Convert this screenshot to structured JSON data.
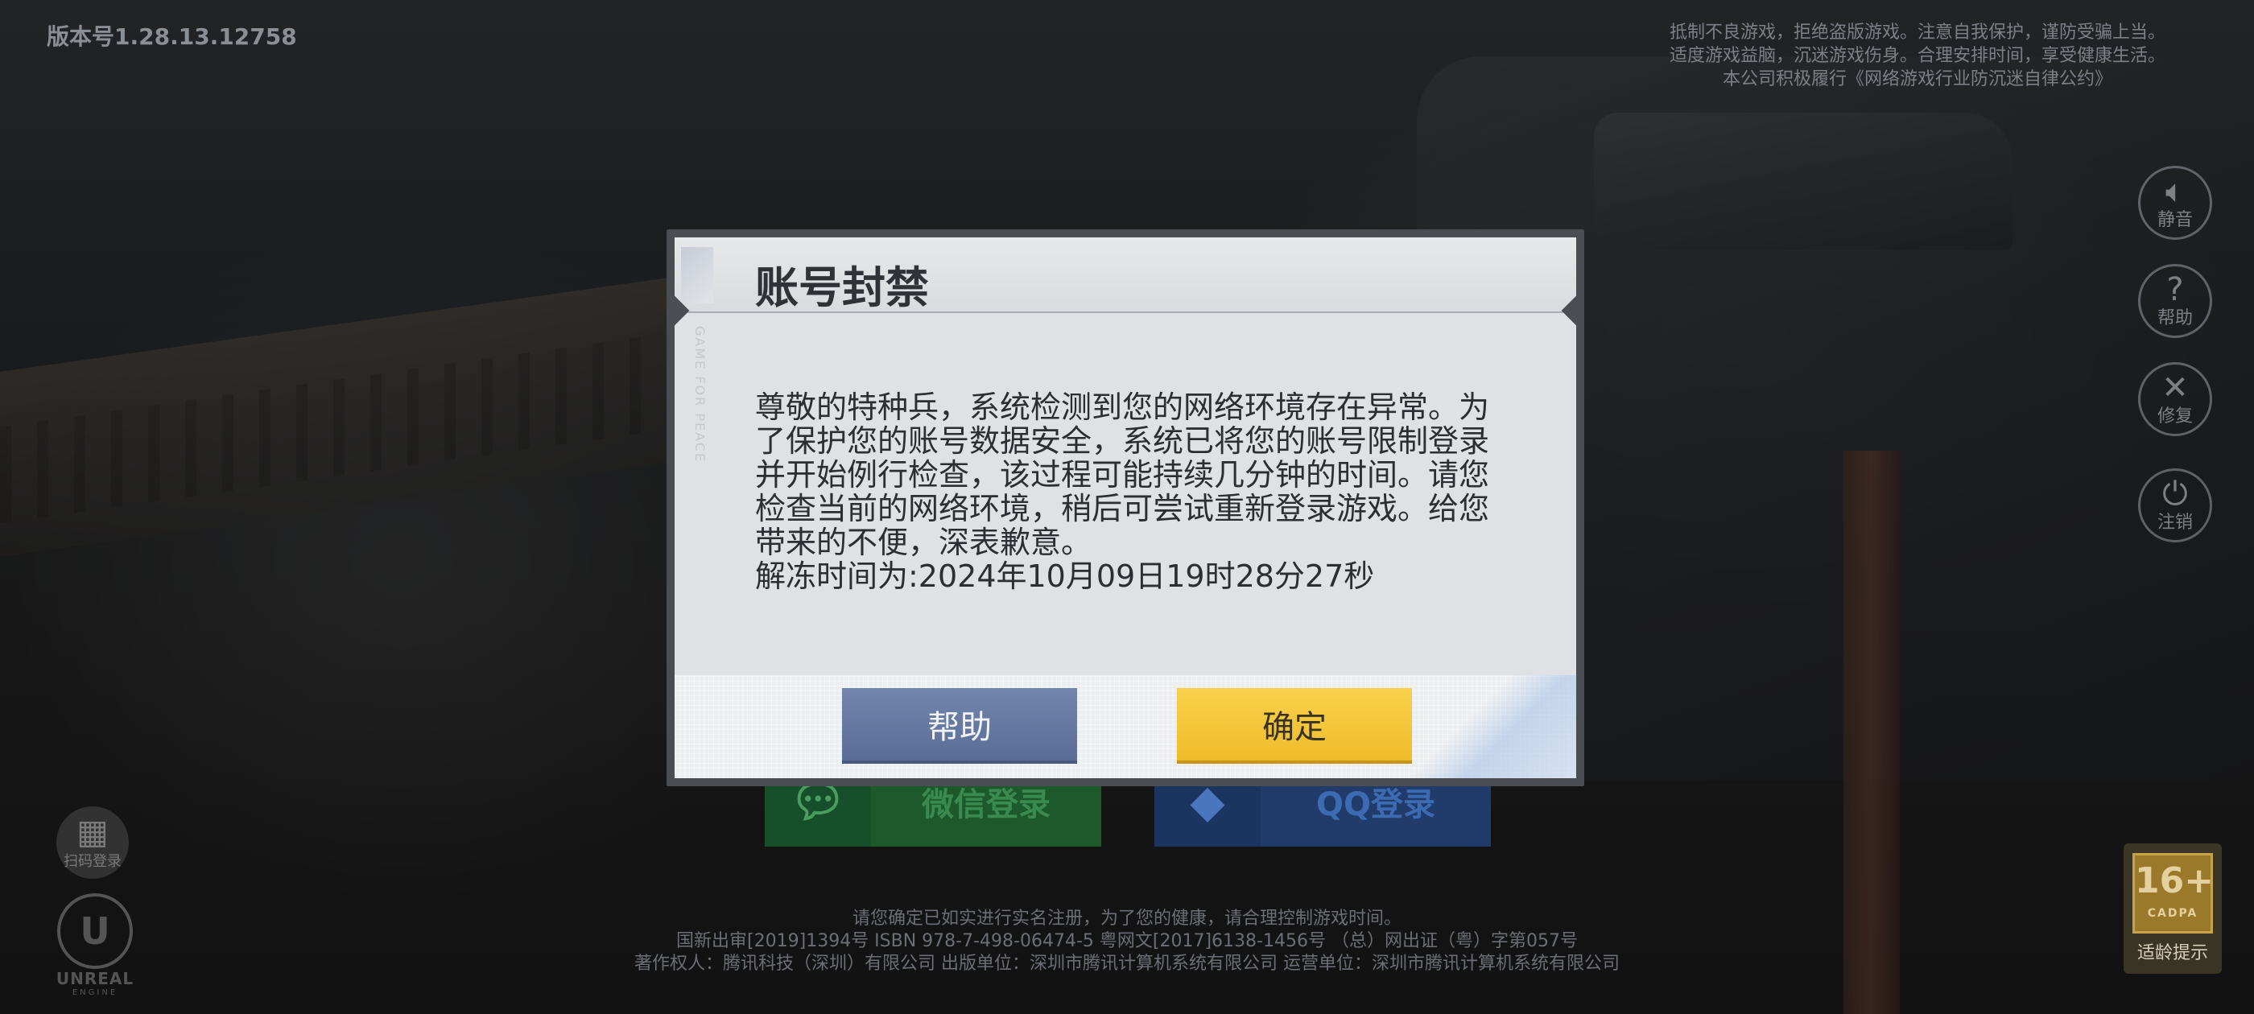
{
  "version": "版本号1.28.13.12758",
  "notice": [
    "抵制不良游戏，拒绝盗版游戏。注意自我保护，谨防受骗上当。",
    "适度游戏益脑，沉迷游戏伤身。合理安排时间，享受健康生活。",
    "本公司积极履行《网络游戏行业防沉迷自律公约》"
  ],
  "side_buttons": {
    "mute": {
      "icon": "speaker-icon",
      "label": "静音"
    },
    "help": {
      "icon": "question-icon",
      "label": "帮助"
    },
    "repair": {
      "icon": "wrench-icon",
      "label": "修复"
    },
    "logout": {
      "icon": "power-icon",
      "label": "注销"
    }
  },
  "qr_button": {
    "icon": "qr-code-icon",
    "label": "扫码登录"
  },
  "engine": {
    "line1": "UNREAL",
    "line2": "ENGINE"
  },
  "login": {
    "wechat": "微信登录",
    "qq": "QQ登录"
  },
  "legal": [
    "请您确定已如实进行实名注册，为了您的健康，请合理控制游戏时间。",
    "国新出审[2019]1394号  ISBN 978-7-498-06474-5  粤网文[2017]6138-1456号  （总）网出证（粤）字第057号",
    "著作权人：腾讯科技（深圳）有限公司  出版单位：深圳市腾讯计算机系统有限公司  运营单位：深圳市腾讯计算机系统有限公司"
  ],
  "age_rating": {
    "number": "16+",
    "org": "CADPA",
    "label": "适龄提示"
  },
  "dialog": {
    "title": "账号封禁",
    "watermark": "GAME FOR PEACE",
    "message": "尊敬的特种兵，系统检测到您的网络环境存在异常。为了保护您的账号数据安全，系统已将您的账号限制登录并开始例行检查，该过程可能持续几分钟的时间。请您检查当前的网络环境，稍后可尝试重新登录游戏。给您带来的不便，深表歉意。",
    "unlock_time": "解冻时间为:2024年10月09日19时28分27秒",
    "help_button": "帮助",
    "confirm_button": "确定"
  },
  "colors": {
    "help_button": "#6478a2",
    "confirm_button": "#f3c53a",
    "wechat": "#1c5a2c",
    "qq": "#213c6a"
  }
}
